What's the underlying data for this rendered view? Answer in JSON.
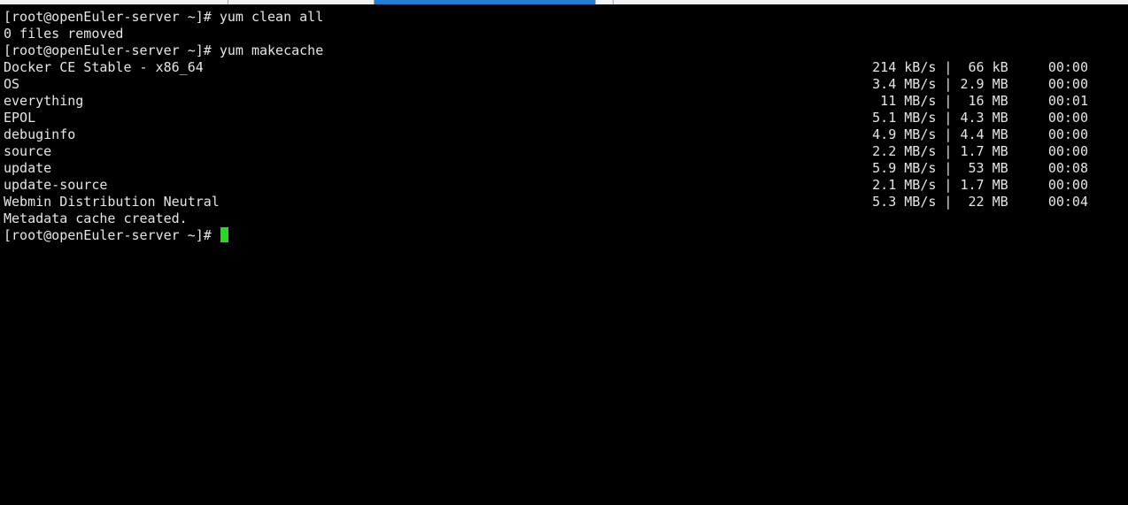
{
  "window": {
    "active_tab_color": "#1e7fd6",
    "cursor_color": "#22dd22"
  },
  "terminal": {
    "lines": [
      "[root@openEuler-server ~]# yum clean all",
      "0 files removed",
      "[root@openEuler-server ~]# yum makecache"
    ],
    "repos": [
      {
        "name": "Docker CE Stable - x86_64",
        "stats": "214 kB/s |  66 kB     00:00"
      },
      {
        "name": "OS",
        "stats": "3.4 MB/s | 2.9 MB     00:00"
      },
      {
        "name": "everything",
        "stats": " 11 MB/s |  16 MB     00:01"
      },
      {
        "name": "EPOL",
        "stats": "5.1 MB/s | 4.3 MB     00:00"
      },
      {
        "name": "debuginfo",
        "stats": "4.9 MB/s | 4.4 MB     00:00"
      },
      {
        "name": "source",
        "stats": "2.2 MB/s | 1.7 MB     00:00"
      },
      {
        "name": "update",
        "stats": "5.9 MB/s |  53 MB     00:08"
      },
      {
        "name": "update-source",
        "stats": "2.1 MB/s | 1.7 MB     00:00"
      },
      {
        "name": "Webmin Distribution Neutral",
        "stats": "5.3 MB/s |  22 MB     00:04"
      }
    ],
    "footer_line": "Metadata cache created.",
    "prompt": "[root@openEuler-server ~]# "
  }
}
